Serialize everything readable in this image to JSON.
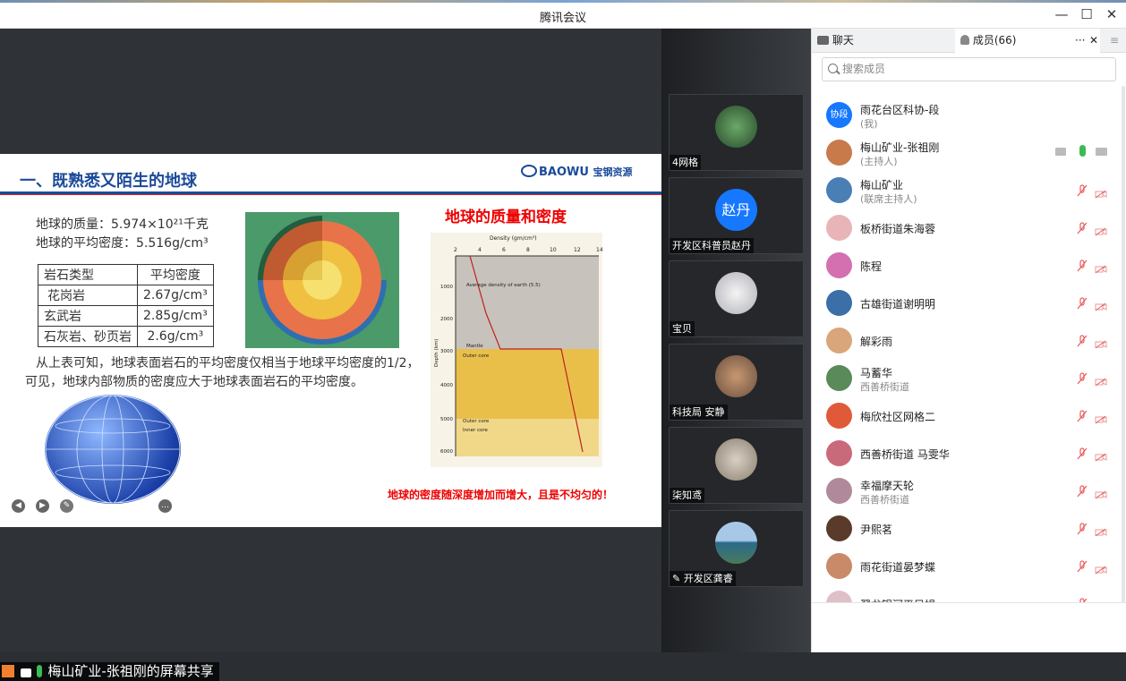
{
  "window": {
    "title": "腾讯会议",
    "minimize": "—",
    "maximize": "☐",
    "close": "✕"
  },
  "slide": {
    "heading": "一、既熟悉又陌生的地球",
    "logo_text": "BAOWU",
    "logo_cn": "宝钢资源",
    "mass_line": "地球的质量：5.974×10²¹千克",
    "density_line": "地球的平均密度：5.516g/cm³",
    "table_headers": [
      "岩石类型",
      "平均密度"
    ],
    "table_rows": [
      [
        "花岗岩",
        "2.67g/cm³"
      ],
      [
        "玄武岩",
        "2.85g/cm³"
      ],
      [
        "石灰岩、砂页岩",
        "2.6g/cm³"
      ]
    ],
    "paragraph_1": "从上表可知，地球表面岩石的平均密度仅相当于地球平均密度的1/2，",
    "paragraph_2": "可见，地球内部物质的密度应大于地球表面岩石的平均密度。",
    "right_title": "地球的质量和密度",
    "chart_title": "Density (gm/cm³)",
    "chart_ticks_x": [
      "2",
      "4",
      "6",
      "8",
      "10",
      "12",
      "14"
    ],
    "chart_ticks_y": [
      "1000",
      "2000",
      "3000",
      "4000",
      "5000",
      "6000"
    ],
    "chart_ylabel": "Depth (km)",
    "chart_labels": [
      "Average density of earth (5.5)",
      "Mantle",
      "Outer core",
      "Outer core",
      "Inner core"
    ],
    "bottom_note": "地球的密度随深度增加而增大，且是不均匀的！"
  },
  "share_bar": {
    "text": "梅山矿业-张祖刚的屏幕共享"
  },
  "video_tiles": [
    {
      "name": "4网格"
    },
    {
      "name": "开发区科普员赵丹",
      "avatar_text": "赵丹"
    },
    {
      "name": "宝贝"
    },
    {
      "name": "科技局 安静"
    },
    {
      "name": "柒知鸢"
    },
    {
      "name": "开发区龚睿"
    }
  ],
  "panel": {
    "tab_chat": "聊天",
    "tab_members": "成员(66)",
    "more": "···",
    "close": "✕",
    "menu": "≡",
    "search_placeholder": "搜索成员"
  },
  "members": [
    {
      "name": "雨花台区科协-段",
      "sub": "(我)",
      "avatar_text": "协段",
      "color": "#1677ff"
    },
    {
      "name": "梅山矿业-张祖刚",
      "sub": "(主持人)",
      "color": "#c97a4a"
    },
    {
      "name": "梅山矿业",
      "sub": "(联席主持人)",
      "color": "#4a7fb5"
    },
    {
      "name": "板桥街道朱海蓉",
      "sub": "",
      "color": "#e8b4b8"
    },
    {
      "name": "陈程",
      "sub": "",
      "color": "#d46fb0"
    },
    {
      "name": "古雄街道谢明明",
      "sub": "",
      "color": "#3a6fa8"
    },
    {
      "name": "解彩雨",
      "sub": "",
      "color": "#d9a57a"
    },
    {
      "name": "马蓄华",
      "sub": "西善桥街道",
      "color": "#5a8a5a"
    },
    {
      "name": "梅欣社区网格二",
      "sub": "",
      "color": "#e05a3a"
    },
    {
      "name": "西善桥街道 马雯华",
      "sub": "",
      "color": "#c96a7a"
    },
    {
      "name": "幸福摩天轮",
      "sub": "西善桥街道",
      "color": "#b08a9a"
    },
    {
      "name": "尹熙茗",
      "sub": "",
      "color": "#5a3a2a"
    },
    {
      "name": "雨花街道晏梦蝶",
      "sub": "",
      "color": "#c98a6a"
    },
    {
      "name": "翠龙银河平凤娟",
      "sub": "",
      "color": "#e0c0c8"
    }
  ]
}
